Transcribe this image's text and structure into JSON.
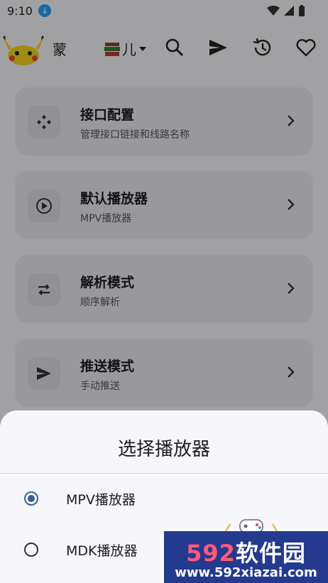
{
  "status": {
    "time": "9:10"
  },
  "toolbar": {
    "app_name": "蒙",
    "source_label": "儿"
  },
  "cards": [
    {
      "title": "接口配置",
      "subtitle": "管理接口链接和线路名称",
      "icon": "api-config-icon"
    },
    {
      "title": "默认播放器",
      "subtitle": "MPV播放器",
      "icon": "play-circle-icon"
    },
    {
      "title": "解析模式",
      "subtitle": "顺序解析",
      "icon": "swap-icon"
    },
    {
      "title": "推送模式",
      "subtitle": "手动推送",
      "icon": "send-icon"
    }
  ],
  "sheet": {
    "title": "选择播放器",
    "options": [
      {
        "label": "MPV播放器",
        "selected": true
      },
      {
        "label": "MDK播放器",
        "selected": false
      }
    ]
  },
  "watermark": {
    "brand_num": "592",
    "brand_text": "软件园",
    "url": "www.592xiazai.com"
  },
  "colors": {
    "accent": "#3b5f91",
    "sheet_bg": "#f7f7fb",
    "watermark_bg": "#243a8f"
  }
}
